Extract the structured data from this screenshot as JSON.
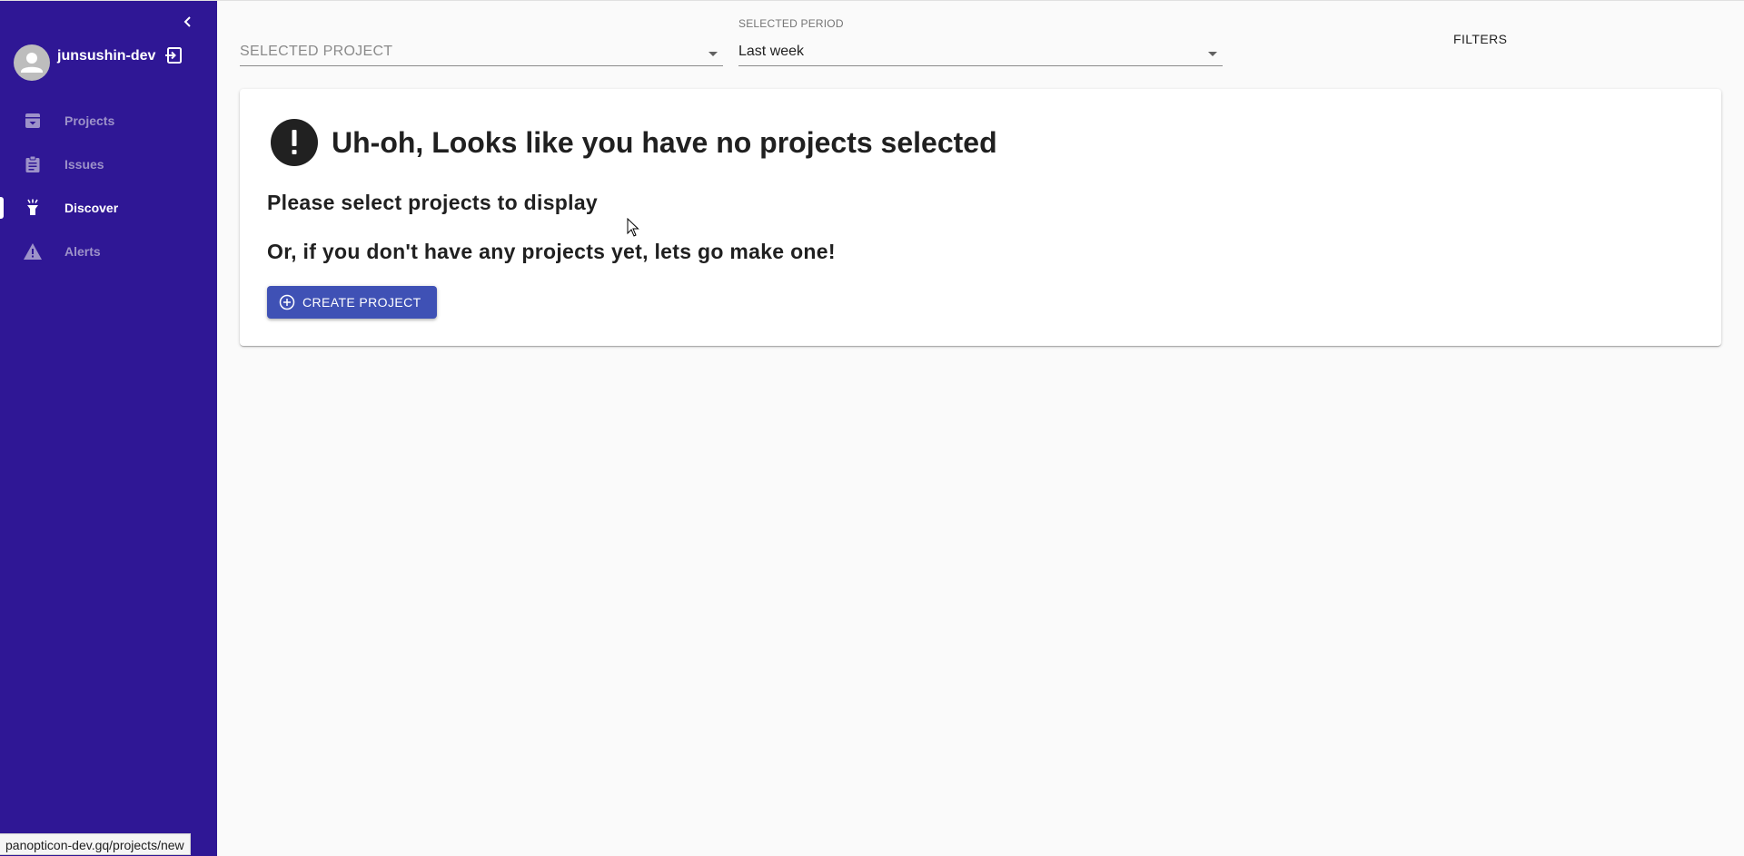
{
  "sidebar": {
    "collapse_icon": "chevron-left-icon",
    "user": {
      "name": "junsushin-dev",
      "avatar_icon": "person-icon",
      "logout_icon": "logout-icon"
    },
    "items": [
      {
        "label": "Projects",
        "icon": "archive-box-icon",
        "active": false
      },
      {
        "label": "Issues",
        "icon": "clipboard-icon",
        "active": false
      },
      {
        "label": "Discover",
        "icon": "flashlight-icon",
        "active": true
      },
      {
        "label": "Alerts",
        "icon": "warning-icon",
        "active": false
      }
    ],
    "background_color": "#2f1795"
  },
  "filters": {
    "project": {
      "label": "SELECTED PROJECT",
      "value": ""
    },
    "period": {
      "label": "SELECTED PERIOD",
      "value": "Last week"
    },
    "filters_link": "FILTERS"
  },
  "empty_state": {
    "icon": "alert-circle-icon",
    "title": "Uh-oh, Looks like you have no projects selected",
    "line1": "Please select projects to display",
    "line2": "Or, if you don't have any projects yet, lets go make one!",
    "button_label": "CREATE PROJECT",
    "button_icon": "plus-circle-icon",
    "button_color": "#3f51b5"
  },
  "statusbar": {
    "url": "panopticon-dev.gq/projects/new"
  }
}
